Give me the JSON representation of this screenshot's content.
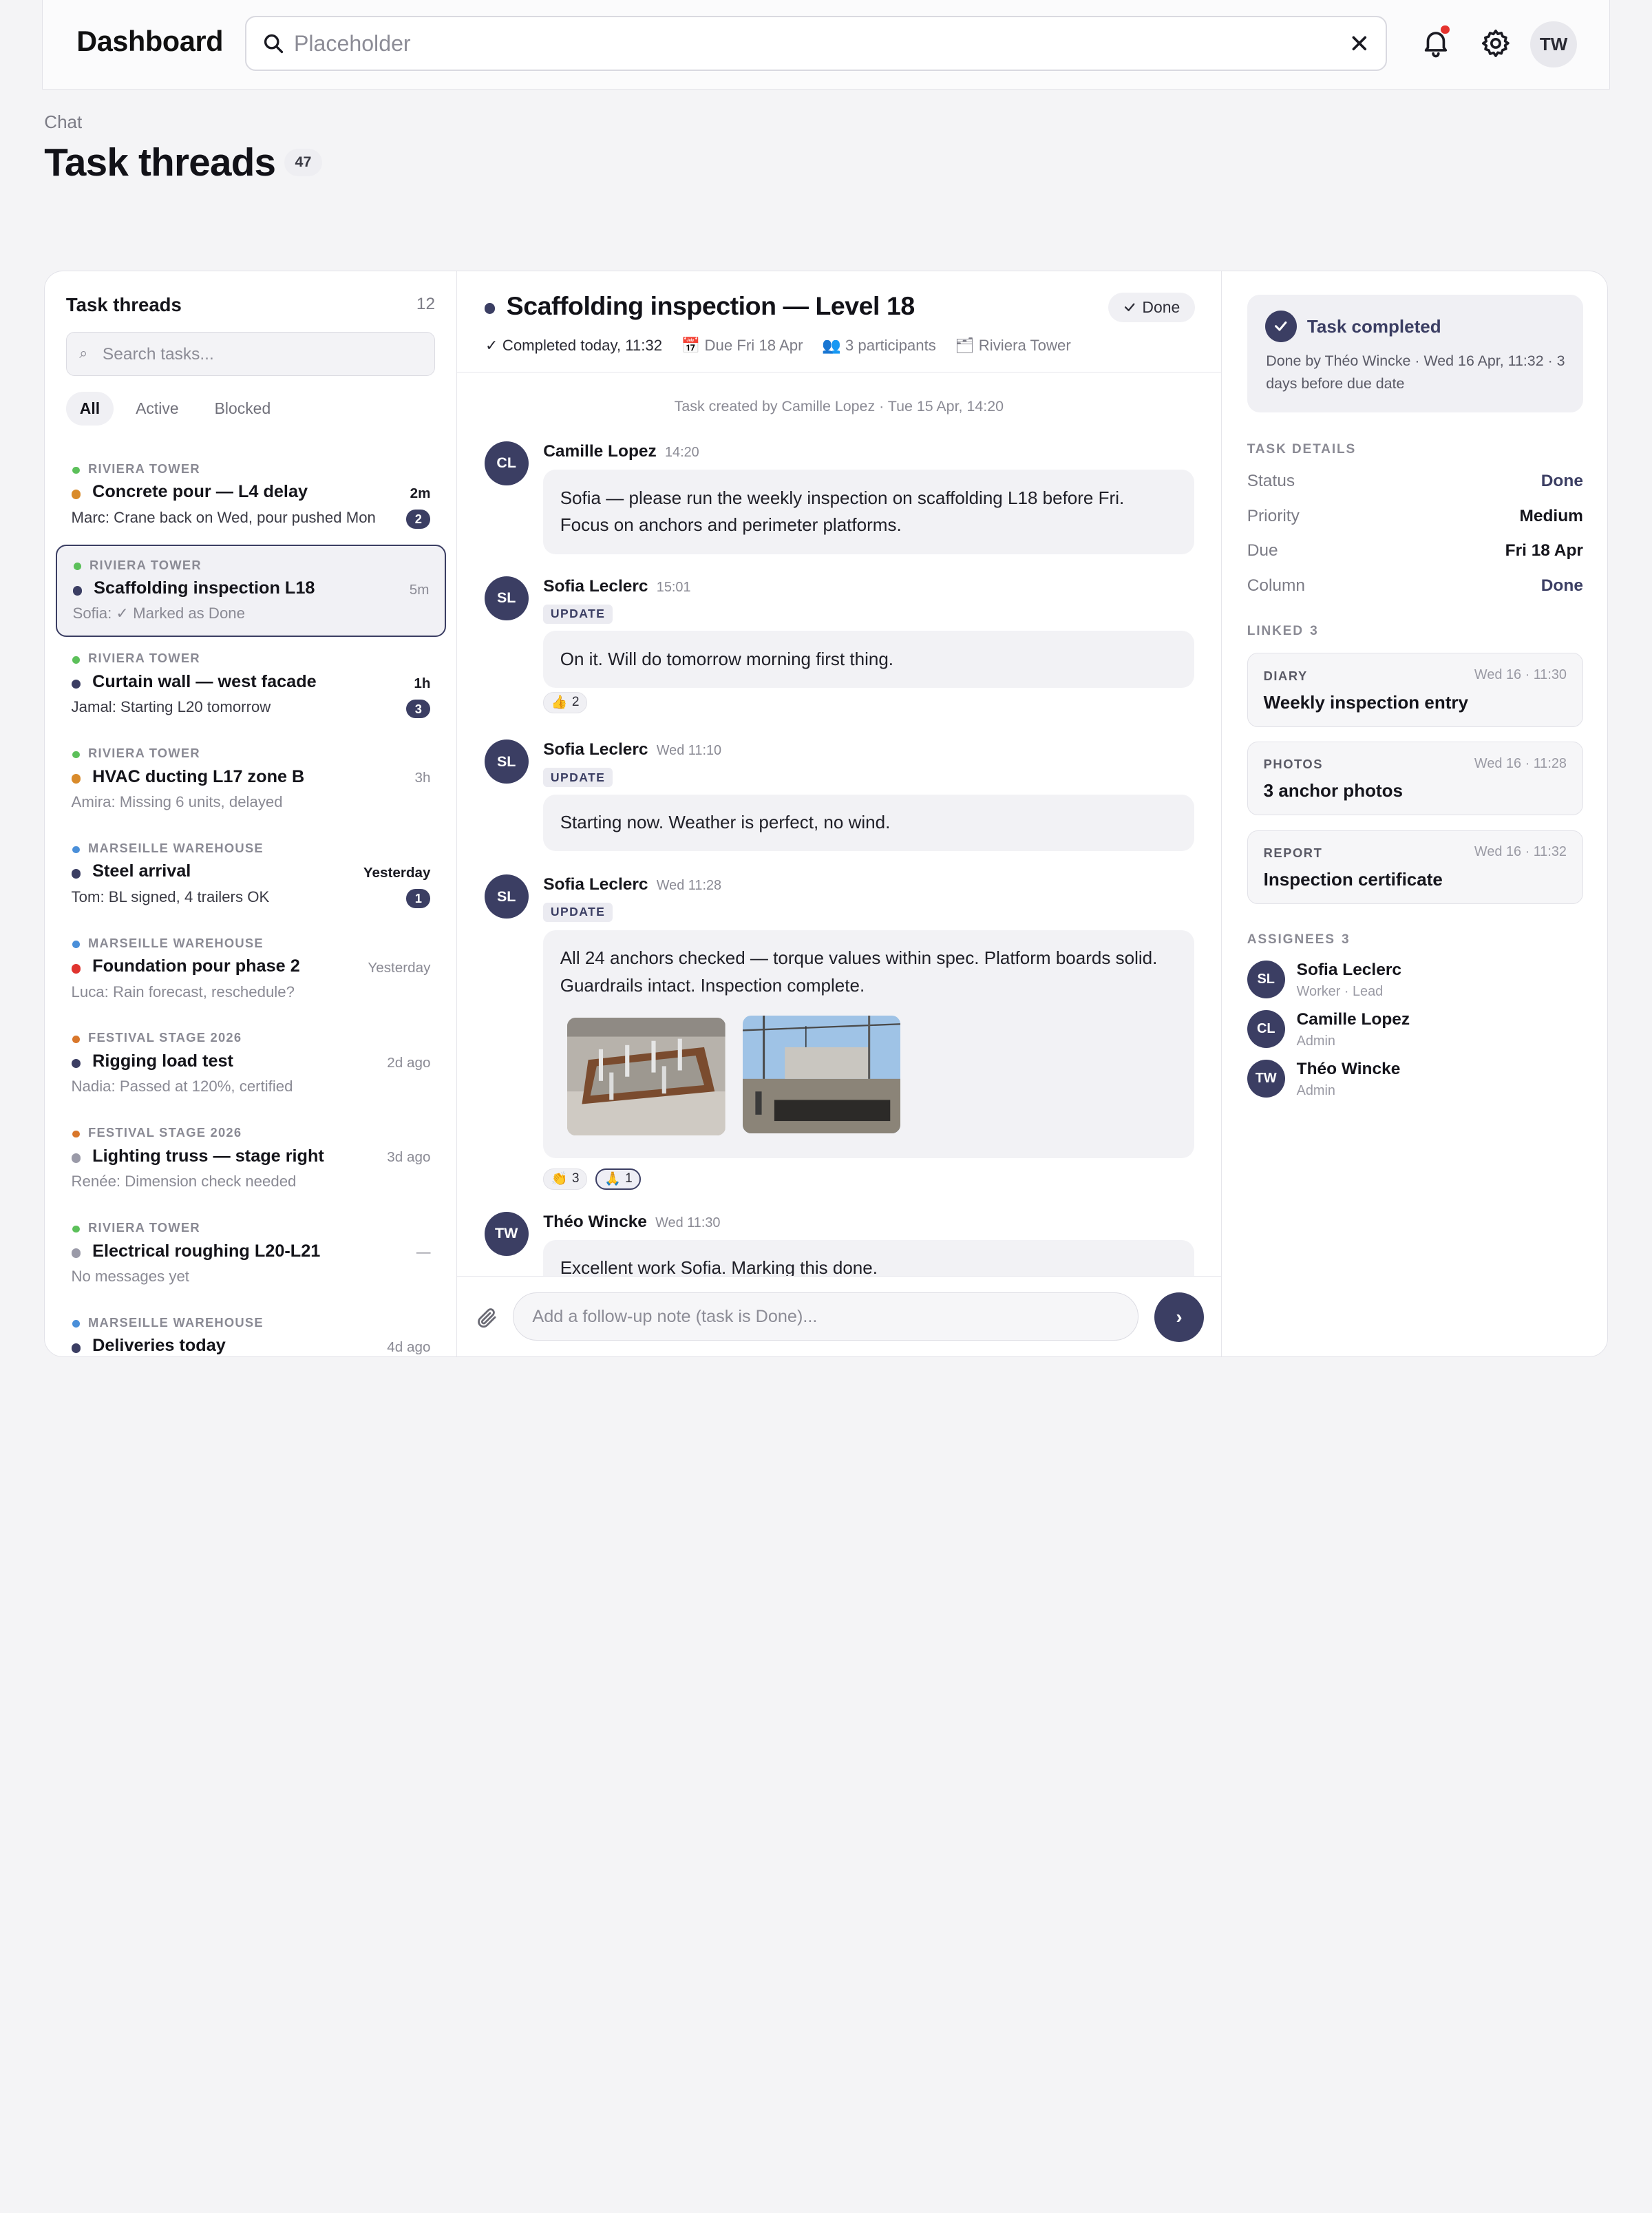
{
  "topbar": {
    "brand": "Dashboard",
    "search_placeholder": "Placeholder",
    "user_initials": "TW",
    "icons": [
      "search-icon",
      "clear-icon",
      "bell-icon",
      "gear-icon"
    ]
  },
  "heading": {
    "crumb": "Chat",
    "title": "Task threads",
    "count": "47"
  },
  "threads_panel": {
    "title": "Task threads",
    "count": "12",
    "search_placeholder": "Search tasks...",
    "filters": [
      "All",
      "Active",
      "Blocked"
    ],
    "active_filter": "All",
    "items": [
      {
        "project": "Riviera Tower",
        "project_color": "#5cc05a",
        "status_color": "#d98b2b",
        "name": "Concrete pour — L4 delay",
        "time": "2m",
        "time_bold": true,
        "preview": "Marc: Crane back on Wed, pour pushed Mon",
        "preview_dark": true,
        "unread": "2"
      },
      {
        "project": "Riviera Tower",
        "project_color": "#5cc05a",
        "status_color": "#3b3e63",
        "name": "Scaffolding inspection L18",
        "time": "5m",
        "time_bold": false,
        "preview": "Sofia: ✓ Marked as Done",
        "preview_dark": false,
        "unread": "",
        "selected": true
      },
      {
        "project": "Riviera Tower",
        "project_color": "#5cc05a",
        "status_color": "#3b3e63",
        "name": "Curtain wall — west facade",
        "time": "1h",
        "time_bold": true,
        "preview": "Jamal: Starting L20 tomorrow",
        "preview_dark": true,
        "unread": "3"
      },
      {
        "project": "Riviera Tower",
        "project_color": "#5cc05a",
        "status_color": "#d98b2b",
        "name": "HVAC ducting L17 zone B",
        "time": "3h",
        "time_bold": false,
        "preview": "Amira: Missing 6 units, delayed",
        "preview_dark": false,
        "unread": ""
      },
      {
        "project": "Marseille Warehouse",
        "project_color": "#4a8fd9",
        "status_color": "#3b3e63",
        "name": "Steel arrival",
        "time": "Yesterday",
        "time_bold": true,
        "preview": "Tom: BL signed, 4 trailers OK",
        "preview_dark": true,
        "unread": "1"
      },
      {
        "project": "Marseille Warehouse",
        "project_color": "#4a8fd9",
        "status_color": "#e0342f",
        "name": "Foundation pour phase 2",
        "time": "Yesterday",
        "time_bold": false,
        "preview": "Luca: Rain forecast, reschedule?",
        "preview_dark": false,
        "unread": ""
      },
      {
        "project": "Festival Stage 2026",
        "project_color": "#d9772b",
        "status_color": "#3b3e63",
        "name": "Rigging load test",
        "time": "2d ago",
        "time_bold": false,
        "preview": "Nadia: Passed at 120%, certified",
        "preview_dark": false,
        "unread": ""
      },
      {
        "project": "Festival Stage 2026",
        "project_color": "#d9772b",
        "status_color": "#9a9aa8",
        "name": "Lighting truss — stage right",
        "time": "3d ago",
        "time_bold": false,
        "preview": "Renée: Dimension check needed",
        "preview_dark": false,
        "unread": ""
      },
      {
        "project": "Riviera Tower",
        "project_color": "#5cc05a",
        "status_color": "#9a9aa8",
        "name": "Electrical roughing L20-L21",
        "time": "—",
        "time_bold": false,
        "preview": "No messages yet",
        "preview_dark": false,
        "unread": ""
      },
      {
        "project": "Marseille Warehouse",
        "project_color": "#4a8fd9",
        "status_color": "#3b3e63",
        "name": "Deliveries today",
        "time": "4d ago",
        "time_bold": false,
        "preview": "",
        "preview_dark": false,
        "unread": ""
      }
    ]
  },
  "chat": {
    "title": "Scaffolding inspection — Level 18",
    "status": "Done",
    "meta": {
      "completed": "Completed today, 11:32",
      "due": "Due Fri 18 Apr",
      "participants": "3 participants",
      "project": "Riviera Tower"
    },
    "system_note": "Task created by Camille Lopez · Tue 15 Apr, 14:20",
    "messages": [
      {
        "initials": "CL",
        "author": "Camille Lopez",
        "time": "14:20",
        "tag": "",
        "text": "Sofia — please run the weekly inspection on scaffolding L18 before Fri. Focus on anchors and perimeter platforms."
      },
      {
        "initials": "SL",
        "author": "Sofia Leclerc",
        "time": "15:01",
        "tag": "UPDATE",
        "text": "On it. Will do tomorrow morning first thing.",
        "reactions": [
          {
            "emoji": "👍",
            "count": "2"
          }
        ]
      },
      {
        "initials": "SL",
        "author": "Sofia Leclerc",
        "time": "Wed 11:10",
        "tag": "UPDATE",
        "text": "Starting now. Weather is perfect, no wind."
      },
      {
        "initials": "SL",
        "author": "Sofia Leclerc",
        "time": "Wed 11:28",
        "tag": "UPDATE",
        "text": "All 24 anchors checked — torque values within spec. Platform boards solid. Guardrails intact. Inspection complete.",
        "reactions": [
          {
            "emoji": "👏",
            "count": "3"
          },
          {
            "emoji": "🙏",
            "count": "1",
            "mine": true
          }
        ]
      },
      {
        "initials": "TW",
        "author": "Théo Wincke",
        "time": "Wed 11:30",
        "tag": "",
        "text": "Excellent work Sofia. Marking this done."
      }
    ],
    "composer_placeholder": "Add a follow-up note (task is Done)...",
    "send_label": "›"
  },
  "details": {
    "completed_title": "Task completed",
    "completed_desc": "Done by Théo Wincke · Wed 16 Apr, 11:32 · 3 days before due date",
    "section_task": "Task details",
    "fields": [
      {
        "key": "Status",
        "value": "Done",
        "color": "#3b3e63"
      },
      {
        "key": "Priority",
        "value": "Medium",
        "color": "#15151c"
      },
      {
        "key": "Due",
        "value": "Fri 18 Apr",
        "color": "#15151c"
      },
      {
        "key": "Column",
        "value": "Done",
        "color": "#3b3e63"
      }
    ],
    "section_linked": "Linked",
    "linked_count": "3",
    "linked": [
      {
        "type": "Diary",
        "time": "Wed 16 · 11:30",
        "name": "Weekly inspection entry"
      },
      {
        "type": "Photos",
        "time": "Wed 16 · 11:28",
        "name": "3 anchor photos"
      },
      {
        "type": "Report",
        "time": "Wed 16 · 11:32",
        "name": "Inspection certificate"
      }
    ],
    "section_assignees": "Assignees",
    "assignees_count": "3",
    "assignees": [
      {
        "initials": "SL",
        "name": "Sofia Leclerc",
        "role": "Worker · Lead"
      },
      {
        "initials": "CL",
        "name": "Camille Lopez",
        "role": "Admin"
      },
      {
        "initials": "TW",
        "name": "Théo Wincke",
        "role": "Admin"
      }
    ]
  },
  "colors": {
    "accent": "#3b3e63",
    "notification": "#e5322d"
  }
}
